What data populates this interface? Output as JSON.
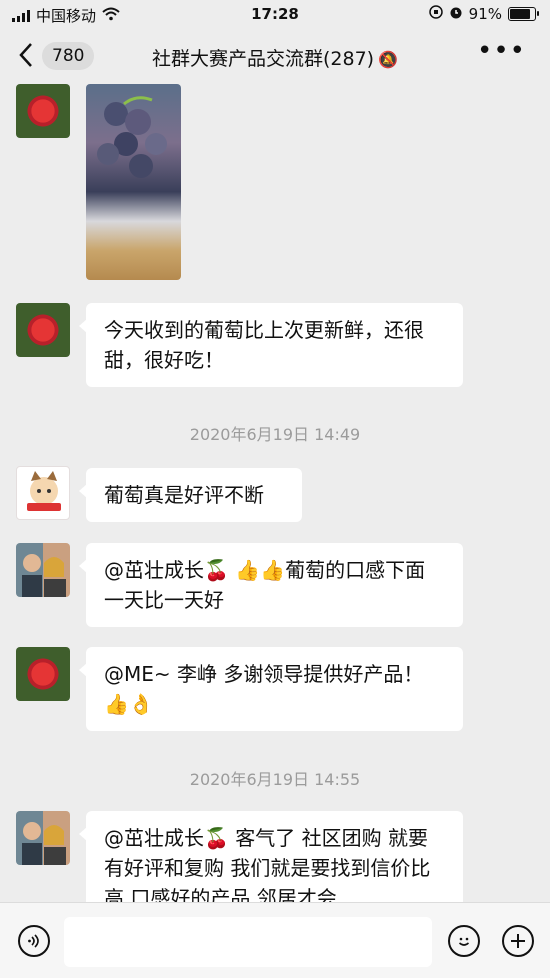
{
  "status_bar": {
    "carrier": "中国移动",
    "time": "17:28",
    "battery": "91%",
    "battery_level": 0.91
  },
  "nav": {
    "back_count": "780",
    "title": "社群大赛产品交流群(287)"
  },
  "messages": [
    {
      "type": "image",
      "sender": "rose"
    },
    {
      "type": "text",
      "sender": "rose",
      "text": "今天收到的葡萄比上次更新鲜，还很甜，很好吃！"
    },
    {
      "type": "timestamp",
      "text": "2020年6月19日 14:49"
    },
    {
      "type": "text",
      "sender": "cat",
      "text": "葡萄真是好评不断"
    },
    {
      "type": "text",
      "sender": "couple",
      "text": "@茁壮成长🍒 👍👍葡萄的口感下面一天比一天好"
    },
    {
      "type": "text",
      "sender": "rose",
      "text": "@ME~ 李峥 多谢领导提供好产品！👍👌"
    },
    {
      "type": "timestamp",
      "text": "2020年6月19日 14:55"
    },
    {
      "type": "text",
      "sender": "couple",
      "text": "@茁壮成长🍒 客气了 社区团购 就要有好评和复购 我们就是要找到信价比高 口感好的产品 邻居才会"
    }
  ],
  "input": {
    "placeholder": ""
  },
  "icons": {
    "voice": "voice-icon",
    "emoji": "emoji-icon",
    "plus": "plus-icon"
  }
}
